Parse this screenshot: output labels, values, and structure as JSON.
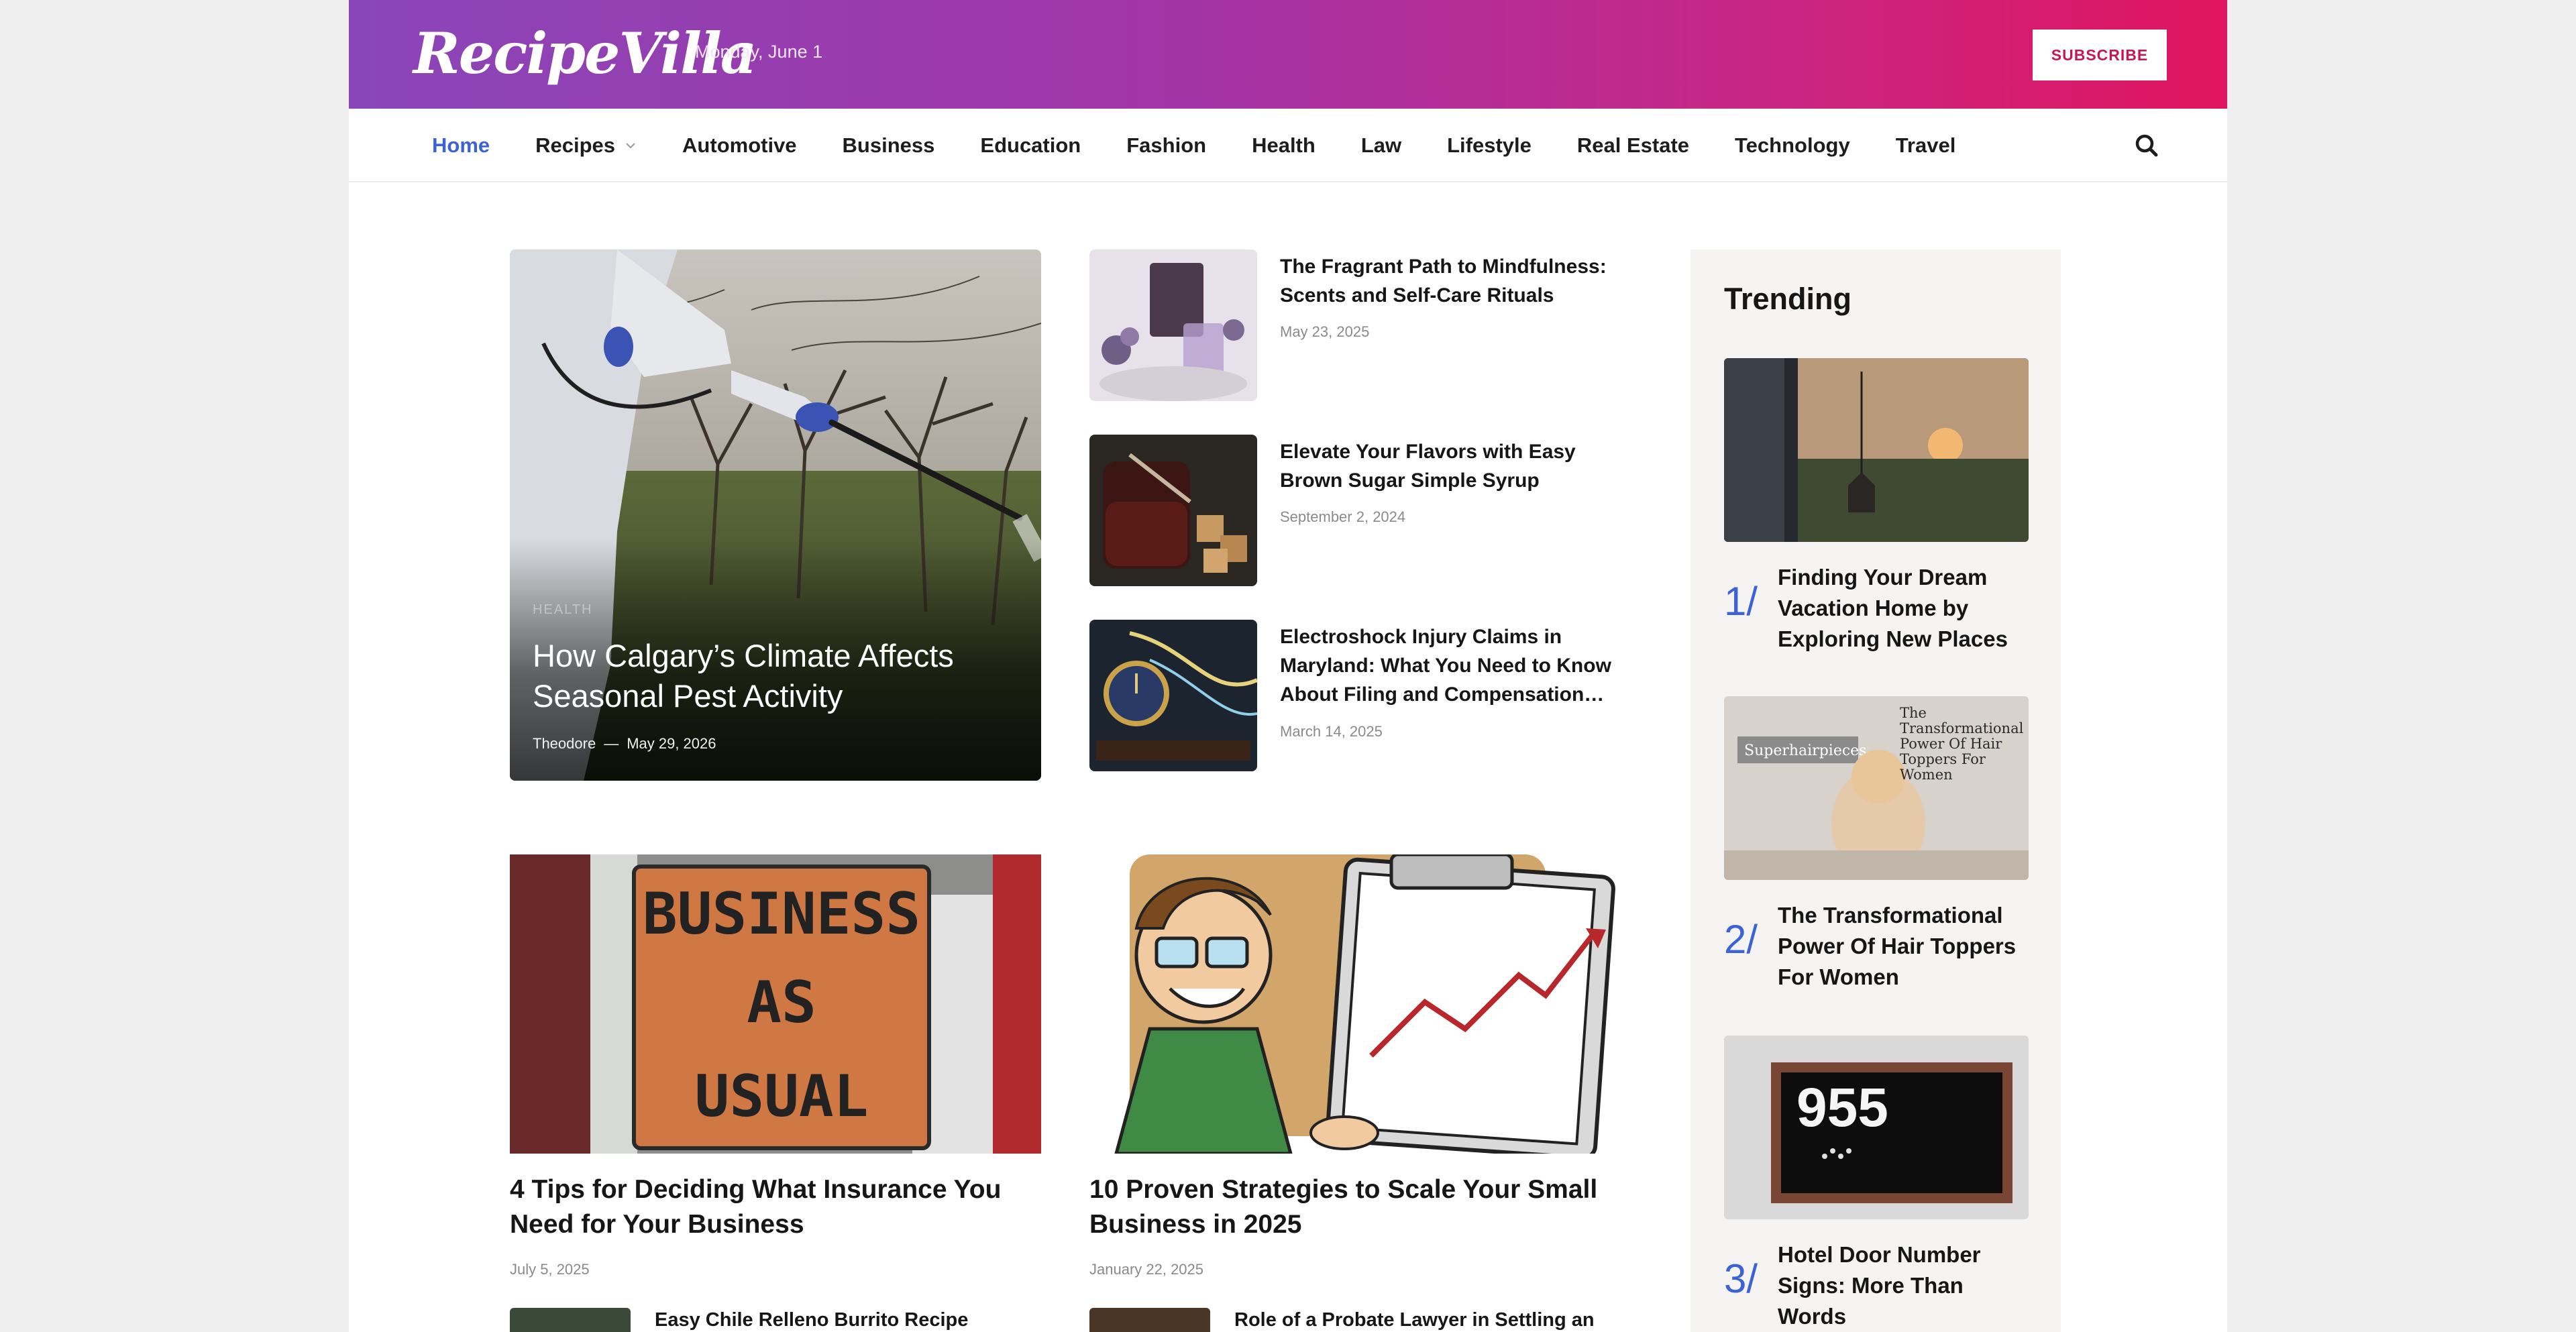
{
  "header": {
    "logo": "RecipeVilla",
    "date": "Monday, June 1",
    "subscribe_label": "SUBSCRIBE"
  },
  "nav": {
    "items": [
      {
        "label": "Home",
        "active": true
      },
      {
        "label": "Recipes",
        "has_dropdown": true
      },
      {
        "label": "Automotive"
      },
      {
        "label": "Business"
      },
      {
        "label": "Education"
      },
      {
        "label": "Fashion"
      },
      {
        "label": "Health"
      },
      {
        "label": "Law"
      },
      {
        "label": "Lifestyle"
      },
      {
        "label": "Real Estate"
      },
      {
        "label": "Technology"
      },
      {
        "label": "Travel"
      }
    ],
    "search_icon": "search-icon"
  },
  "featured": {
    "category": "HEALTH",
    "title": "How Calgary’s Climate Affects Seasonal Pest Activity",
    "author": "Theodore",
    "separator": "—",
    "date": "May 29, 2026"
  },
  "small_posts": [
    {
      "title": "The Fragrant Path to Mindfulness: Scents and Self-Care Rituals",
      "date": "May 23, 2025"
    },
    {
      "title": "Elevate Your Flavors with Easy Brown Sugar Simple Syrup",
      "date": "September 2, 2024"
    },
    {
      "title": "Electroshock Injury Claims in Maryland: What You Need to Know About Filing and Compensation…",
      "date": "March 14, 2025"
    }
  ],
  "cards": [
    {
      "title": "4 Tips for Deciding What Insurance You Need for Your Business",
      "date": "July 5, 2025",
      "image_text": [
        "BUSINESS",
        "AS",
        "USUAL"
      ],
      "mini_title": "Easy Chile Relleno Burrito Recipe"
    },
    {
      "title": "10 Proven Strategies to Scale Your Small Business in 2025",
      "date": "January 22, 2025",
      "mini_title": "Role of a Probate Lawyer in Settling an"
    }
  ],
  "trending": {
    "heading": "Trending",
    "items": [
      {
        "num": "1/",
        "title": "Finding Your Dream Vacation Home by Exploring New Places"
      },
      {
        "num": "2/",
        "title": "The Transformational Power Of Hair Toppers For Women",
        "image_text": [
          "The",
          "Transformational",
          "Power Of Hair",
          "Toppers For",
          "Women"
        ],
        "sign": "Superhairpieces"
      },
      {
        "num": "3/",
        "title": "Hotel Door Number Signs: More Than Words",
        "image_text": "955"
      }
    ]
  }
}
